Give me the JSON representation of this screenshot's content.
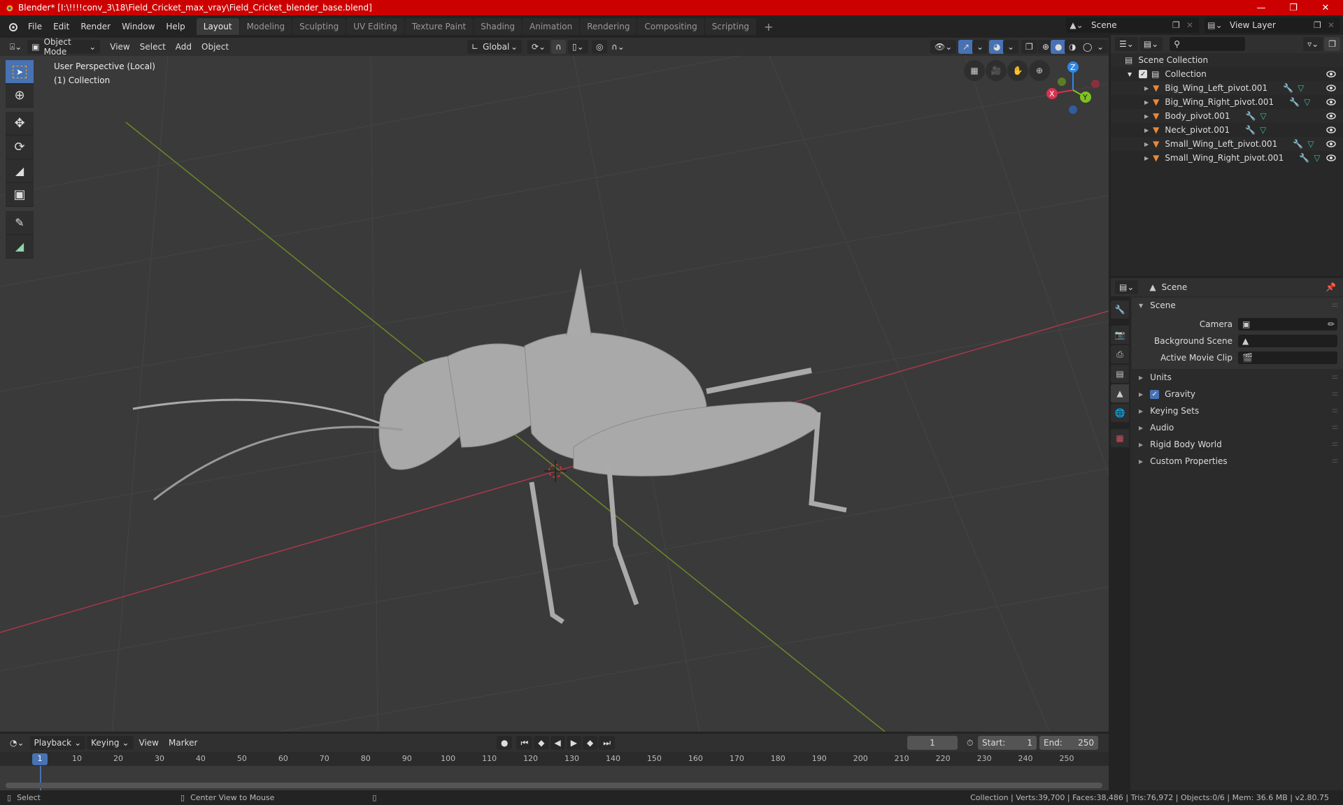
{
  "window": {
    "title": "Blender* [I:\\!!!!conv_3\\18\\Field_Cricket_max_vray\\Field_Cricket_blender_base.blend]",
    "controls": [
      "minimize",
      "maximize",
      "close"
    ]
  },
  "menu": [
    "File",
    "Edit",
    "Render",
    "Window",
    "Help"
  ],
  "workspaces": {
    "tabs": [
      "Layout",
      "Modeling",
      "Sculpting",
      "UV Editing",
      "Texture Paint",
      "Shading",
      "Animation",
      "Rendering",
      "Compositing",
      "Scripting"
    ],
    "active": "Layout",
    "add_label": "+"
  },
  "scene_selector": {
    "value": "Scene"
  },
  "view_layer_selector": {
    "value": "View Layer"
  },
  "viewport_header": {
    "mode": "Object Mode",
    "menus": [
      "View",
      "Select",
      "Add",
      "Object"
    ],
    "transform_orientation": "Global"
  },
  "viewport": {
    "perspective_label": "User Perspective (Local)",
    "collection_label": "(1) Collection",
    "tools": [
      "select-box",
      "cursor",
      "move",
      "rotate",
      "scale",
      "transform",
      "annotate",
      "measure"
    ],
    "active_tool": "select-box",
    "nav_buttons": [
      "toggle-camera-grid",
      "camera-view",
      "pan",
      "zoom"
    ],
    "gizmo_axes": [
      "X",
      "Y",
      "Z"
    ],
    "shading_mode": "solid"
  },
  "outliner": {
    "search_placeholder": "",
    "scene_collection": "Scene Collection",
    "collection": "Collection",
    "items": [
      {
        "name": "Big_Wing_Left_pivot.001"
      },
      {
        "name": "Big_Wing_Right_pivot.001"
      },
      {
        "name": "Body_pivot.001"
      },
      {
        "name": "Neck_pivot.001"
      },
      {
        "name": "Small_Wing_Left_pivot.001"
      },
      {
        "name": "Small_Wing_Right_pivot.001"
      }
    ]
  },
  "properties": {
    "context": "Scene",
    "panel_title": "Scene",
    "fields": [
      {
        "label": "Camera",
        "value": ""
      },
      {
        "label": "Background Scene",
        "value": ""
      },
      {
        "label": "Active Movie Clip",
        "value": ""
      }
    ],
    "subpanels": [
      {
        "label": "Units"
      },
      {
        "label": "Gravity",
        "checked": true
      },
      {
        "label": "Keying Sets"
      },
      {
        "label": "Audio"
      },
      {
        "label": "Rigid Body World"
      },
      {
        "label": "Custom Properties"
      }
    ]
  },
  "timeline": {
    "menus": [
      "Playback",
      "Keying",
      "View",
      "Marker"
    ],
    "current_frame": "1",
    "start_label": "Start:",
    "start": "1",
    "end_label": "End:",
    "end": "250",
    "ticks": [
      "1",
      "10",
      "20",
      "30",
      "40",
      "50",
      "60",
      "70",
      "80",
      "90",
      "100",
      "110",
      "120",
      "130",
      "140",
      "150",
      "160",
      "170",
      "180",
      "190",
      "200",
      "210",
      "220",
      "230",
      "240",
      "250"
    ]
  },
  "statusbar": {
    "left_hint": "Select",
    "middle_hint": "Center View to Mouse",
    "stats": "Collection | Verts:39,700 | Faces:38,486 | Tris:76,972 | Objects:0/6 | Mem: 36.6 MB | v2.80.75"
  },
  "colors": {
    "titlebar": "#cc0000",
    "accent": "#4772b3",
    "x_axis": "#d9314f",
    "y_axis": "#7fc31f",
    "z_axis": "#2f87e6",
    "object_icon": "#e8883a",
    "mesh_icon": "#24c3a2",
    "modifier_icon": "#6e9be0"
  }
}
